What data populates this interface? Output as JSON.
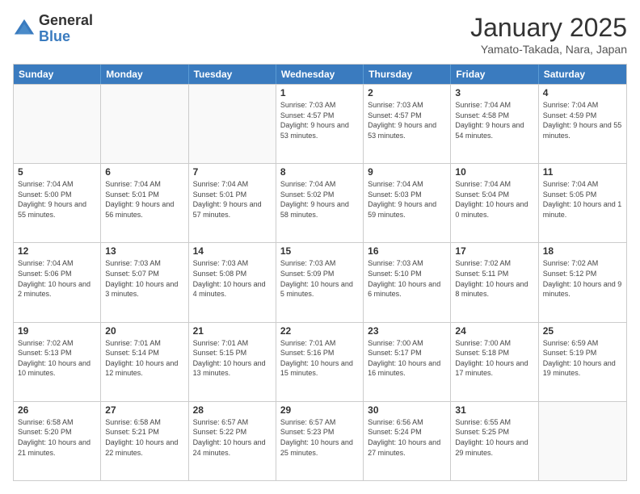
{
  "logo": {
    "general": "General",
    "blue": "Blue"
  },
  "title": "January 2025",
  "subtitle": "Yamato-Takada, Nara, Japan",
  "days": [
    "Sunday",
    "Monday",
    "Tuesday",
    "Wednesday",
    "Thursday",
    "Friday",
    "Saturday"
  ],
  "weeks": [
    [
      {
        "day": "",
        "empty": true
      },
      {
        "day": "",
        "empty": true
      },
      {
        "day": "",
        "empty": true
      },
      {
        "day": "1",
        "sunrise": "Sunrise: 7:03 AM",
        "sunset": "Sunset: 4:57 PM",
        "daylight": "Daylight: 9 hours and 53 minutes."
      },
      {
        "day": "2",
        "sunrise": "Sunrise: 7:03 AM",
        "sunset": "Sunset: 4:57 PM",
        "daylight": "Daylight: 9 hours and 53 minutes."
      },
      {
        "day": "3",
        "sunrise": "Sunrise: 7:04 AM",
        "sunset": "Sunset: 4:58 PM",
        "daylight": "Daylight: 9 hours and 54 minutes."
      },
      {
        "day": "4",
        "sunrise": "Sunrise: 7:04 AM",
        "sunset": "Sunset: 4:59 PM",
        "daylight": "Daylight: 9 hours and 55 minutes."
      }
    ],
    [
      {
        "day": "5",
        "sunrise": "Sunrise: 7:04 AM",
        "sunset": "Sunset: 5:00 PM",
        "daylight": "Daylight: 9 hours and 55 minutes."
      },
      {
        "day": "6",
        "sunrise": "Sunrise: 7:04 AM",
        "sunset": "Sunset: 5:01 PM",
        "daylight": "Daylight: 9 hours and 56 minutes."
      },
      {
        "day": "7",
        "sunrise": "Sunrise: 7:04 AM",
        "sunset": "Sunset: 5:01 PM",
        "daylight": "Daylight: 9 hours and 57 minutes."
      },
      {
        "day": "8",
        "sunrise": "Sunrise: 7:04 AM",
        "sunset": "Sunset: 5:02 PM",
        "daylight": "Daylight: 9 hours and 58 minutes."
      },
      {
        "day": "9",
        "sunrise": "Sunrise: 7:04 AM",
        "sunset": "Sunset: 5:03 PM",
        "daylight": "Daylight: 9 hours and 59 minutes."
      },
      {
        "day": "10",
        "sunrise": "Sunrise: 7:04 AM",
        "sunset": "Sunset: 5:04 PM",
        "daylight": "Daylight: 10 hours and 0 minutes."
      },
      {
        "day": "11",
        "sunrise": "Sunrise: 7:04 AM",
        "sunset": "Sunset: 5:05 PM",
        "daylight": "Daylight: 10 hours and 1 minute."
      }
    ],
    [
      {
        "day": "12",
        "sunrise": "Sunrise: 7:04 AM",
        "sunset": "Sunset: 5:06 PM",
        "daylight": "Daylight: 10 hours and 2 minutes."
      },
      {
        "day": "13",
        "sunrise": "Sunrise: 7:03 AM",
        "sunset": "Sunset: 5:07 PM",
        "daylight": "Daylight: 10 hours and 3 minutes."
      },
      {
        "day": "14",
        "sunrise": "Sunrise: 7:03 AM",
        "sunset": "Sunset: 5:08 PM",
        "daylight": "Daylight: 10 hours and 4 minutes."
      },
      {
        "day": "15",
        "sunrise": "Sunrise: 7:03 AM",
        "sunset": "Sunset: 5:09 PM",
        "daylight": "Daylight: 10 hours and 5 minutes."
      },
      {
        "day": "16",
        "sunrise": "Sunrise: 7:03 AM",
        "sunset": "Sunset: 5:10 PM",
        "daylight": "Daylight: 10 hours and 6 minutes."
      },
      {
        "day": "17",
        "sunrise": "Sunrise: 7:02 AM",
        "sunset": "Sunset: 5:11 PM",
        "daylight": "Daylight: 10 hours and 8 minutes."
      },
      {
        "day": "18",
        "sunrise": "Sunrise: 7:02 AM",
        "sunset": "Sunset: 5:12 PM",
        "daylight": "Daylight: 10 hours and 9 minutes."
      }
    ],
    [
      {
        "day": "19",
        "sunrise": "Sunrise: 7:02 AM",
        "sunset": "Sunset: 5:13 PM",
        "daylight": "Daylight: 10 hours and 10 minutes."
      },
      {
        "day": "20",
        "sunrise": "Sunrise: 7:01 AM",
        "sunset": "Sunset: 5:14 PM",
        "daylight": "Daylight: 10 hours and 12 minutes."
      },
      {
        "day": "21",
        "sunrise": "Sunrise: 7:01 AM",
        "sunset": "Sunset: 5:15 PM",
        "daylight": "Daylight: 10 hours and 13 minutes."
      },
      {
        "day": "22",
        "sunrise": "Sunrise: 7:01 AM",
        "sunset": "Sunset: 5:16 PM",
        "daylight": "Daylight: 10 hours and 15 minutes."
      },
      {
        "day": "23",
        "sunrise": "Sunrise: 7:00 AM",
        "sunset": "Sunset: 5:17 PM",
        "daylight": "Daylight: 10 hours and 16 minutes."
      },
      {
        "day": "24",
        "sunrise": "Sunrise: 7:00 AM",
        "sunset": "Sunset: 5:18 PM",
        "daylight": "Daylight: 10 hours and 17 minutes."
      },
      {
        "day": "25",
        "sunrise": "Sunrise: 6:59 AM",
        "sunset": "Sunset: 5:19 PM",
        "daylight": "Daylight: 10 hours and 19 minutes."
      }
    ],
    [
      {
        "day": "26",
        "sunrise": "Sunrise: 6:58 AM",
        "sunset": "Sunset: 5:20 PM",
        "daylight": "Daylight: 10 hours and 21 minutes."
      },
      {
        "day": "27",
        "sunrise": "Sunrise: 6:58 AM",
        "sunset": "Sunset: 5:21 PM",
        "daylight": "Daylight: 10 hours and 22 minutes."
      },
      {
        "day": "28",
        "sunrise": "Sunrise: 6:57 AM",
        "sunset": "Sunset: 5:22 PM",
        "daylight": "Daylight: 10 hours and 24 minutes."
      },
      {
        "day": "29",
        "sunrise": "Sunrise: 6:57 AM",
        "sunset": "Sunset: 5:23 PM",
        "daylight": "Daylight: 10 hours and 25 minutes."
      },
      {
        "day": "30",
        "sunrise": "Sunrise: 6:56 AM",
        "sunset": "Sunset: 5:24 PM",
        "daylight": "Daylight: 10 hours and 27 minutes."
      },
      {
        "day": "31",
        "sunrise": "Sunrise: 6:55 AM",
        "sunset": "Sunset: 5:25 PM",
        "daylight": "Daylight: 10 hours and 29 minutes."
      },
      {
        "day": "",
        "empty": true
      }
    ]
  ]
}
